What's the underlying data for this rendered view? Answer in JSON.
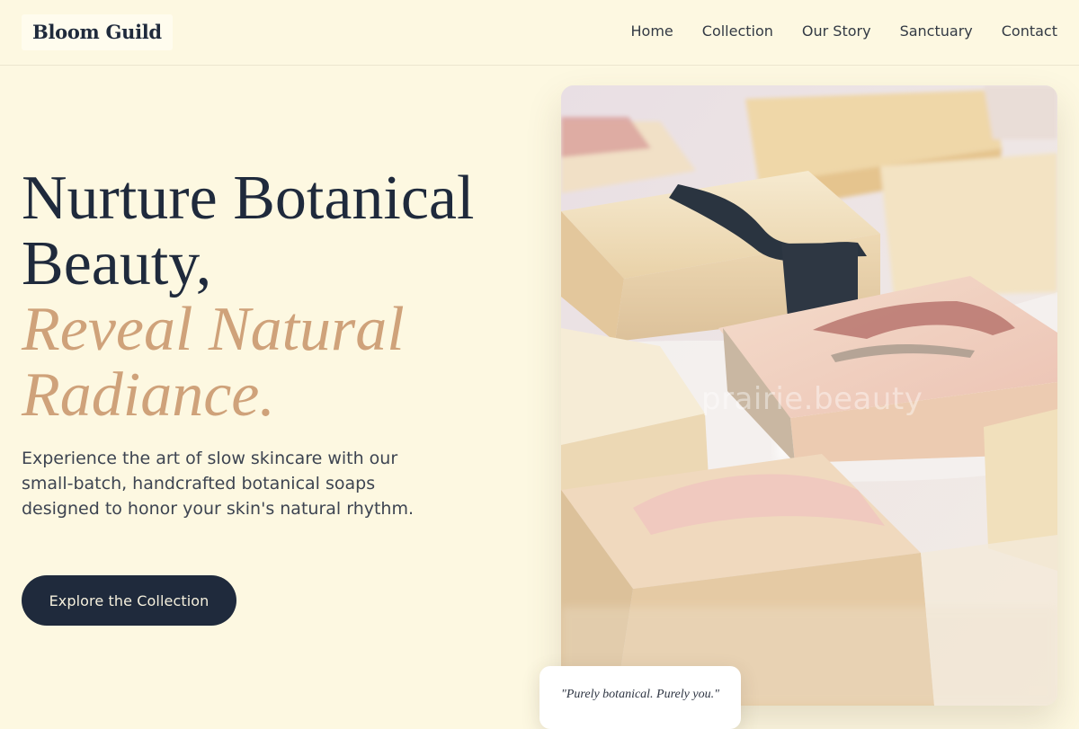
{
  "header": {
    "logo": "Bloom Guild",
    "nav": [
      "Home",
      "Collection",
      "Our Story",
      "Sanctuary",
      "Contact"
    ]
  },
  "hero": {
    "title_line1": "Nurture Botanical Beauty,",
    "title_accent": "Reveal Natural Radiance.",
    "description": "Experience the art of slow skincare with our small-batch, handcrafted botanical soaps designed to honor your skin's natural rhythm.",
    "cta_label": "Explore the Collection"
  },
  "image": {
    "alt": "Handcrafted botanical soap bars",
    "watermark": "prairie.beauty"
  },
  "quote": "\"Purely botanical. Purely you.\"",
  "colors": {
    "background": "#fdf8e1",
    "navy": "#1f2a3c",
    "accent": "#cfa27a"
  }
}
